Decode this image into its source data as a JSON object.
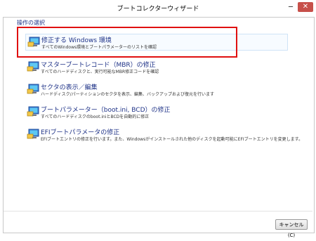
{
  "window": {
    "title": "ブートコレクターウィザード",
    "minimize_glyph": "─",
    "close_glyph": "✕"
  },
  "group_label": "操作の選択",
  "options": [
    {
      "title": "修正する Windows 環境",
      "description": "すべてのWindows環境とブートパラメーターのリストを確認",
      "icon": "monitor-icon"
    },
    {
      "title": "マスターブートレコード（MBR）の修正",
      "description": "すべてのハードディスクと、実行可能なMBR修正コードを確認",
      "icon": "monitor-icon"
    },
    {
      "title": "セクタの表示／編集",
      "description": "ハードディスク/パーティションのセクタを表示、編集、バックアップおよび復元を行います",
      "icon": "monitor-icon"
    },
    {
      "title": "ブートパラメーター（boot.ini, BCD）の修正",
      "description": "すべてのハードディスクのboot.iniとBCDを自動的に修正",
      "icon": "monitor-icon"
    },
    {
      "title": "EFIブートパラメータの修正",
      "description": "EFIブートエントリの修正を行います。また、Windowsがインストールされた他のディスクを起動可能にEFIブートエントリを変更します。",
      "icon": "monitor-icon"
    }
  ],
  "footer": {
    "cancel_label": "キャンセル(C)"
  },
  "colors": {
    "link": "#1e3287",
    "highlight": "#e01010",
    "close_button": "#c7504a"
  }
}
